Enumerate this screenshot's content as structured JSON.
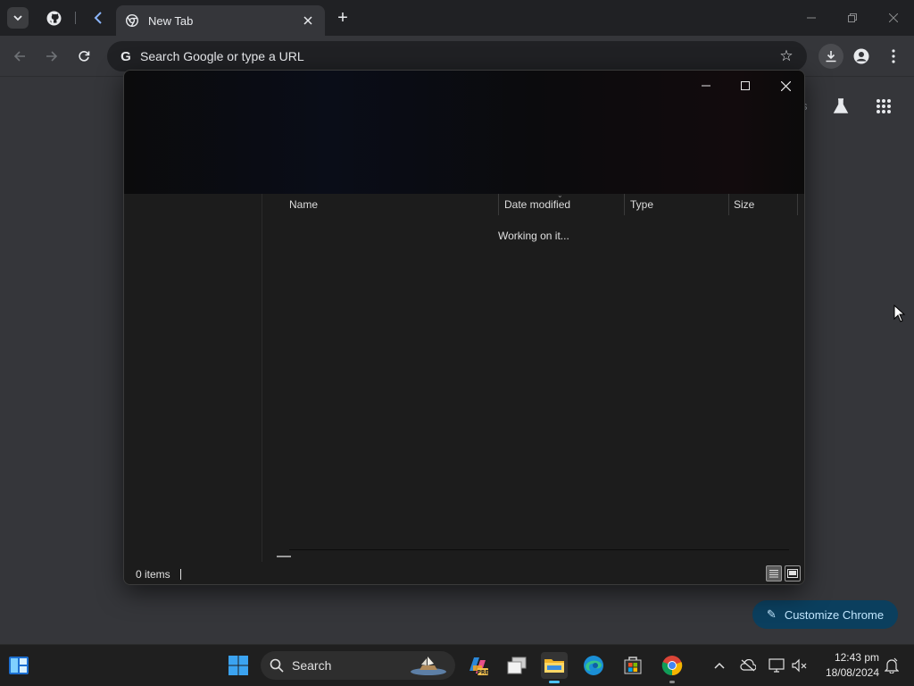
{
  "browser": {
    "tab_title": "New Tab",
    "new_tab_symbol": "+",
    "address_placeholder": "Search Google or type a URL",
    "icons": [
      "tab-search-icon",
      "github-icon",
      "chrome-favicon",
      "close-icon",
      "plus-icon",
      "back-icon",
      "forward-icon",
      "reload-icon",
      "google-g-icon",
      "star-icon",
      "download-icon",
      "profile-icon",
      "more-icon"
    ]
  },
  "ntp": {
    "partial_label": "s",
    "customize_label": "Customize Chrome"
  },
  "explorer": {
    "columns": {
      "name": "Name",
      "date_modified": "Date modified",
      "type": "Type",
      "size": "Size"
    },
    "loading_text": "Working on it...",
    "status_count": "0 items"
  },
  "taskbar": {
    "search_label": "Search",
    "time": "12:43 pm",
    "date": "18/08/2024"
  },
  "colors": {
    "accent": "#4cc2ff",
    "customize_bg": "#0b3f5e",
    "customize_text": "#c2e7ff"
  }
}
